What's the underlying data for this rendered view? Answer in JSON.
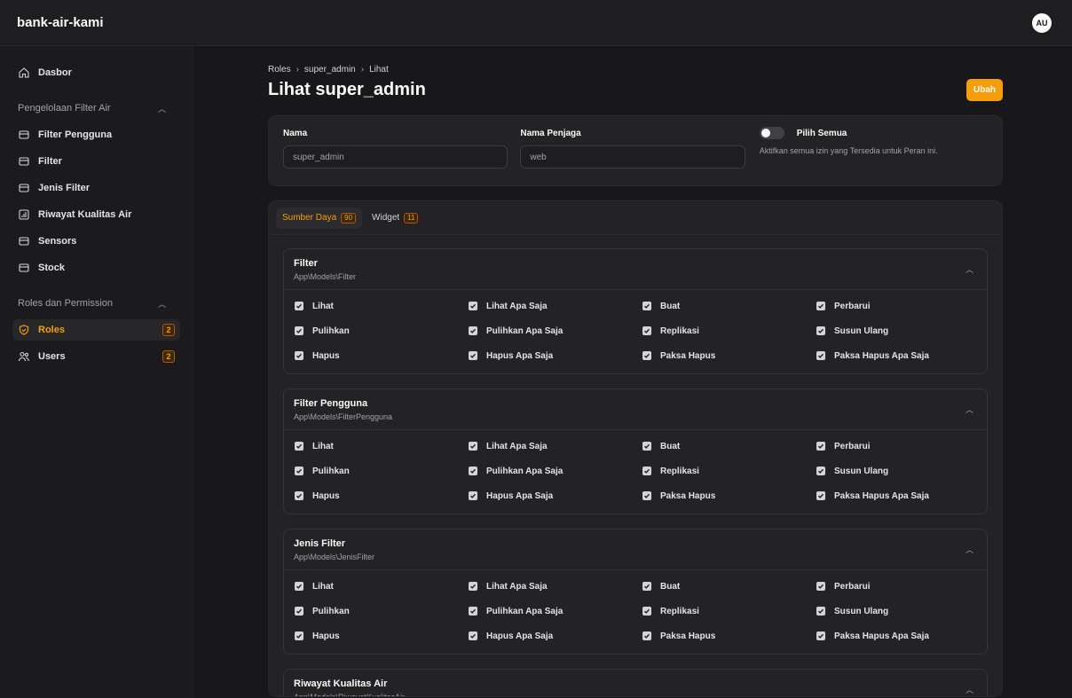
{
  "app": {
    "title": "bank-air-kami",
    "user_initials": "AU"
  },
  "colors": {
    "accent": "#f59e0b",
    "background": "#18181b",
    "surface": "#232326"
  },
  "sidebar": {
    "dashboard": {
      "label": "Dasbor",
      "icon": "home-icon"
    },
    "groups": [
      {
        "label": "Pengelolaan Filter Air",
        "items": [
          {
            "label": "Filter Pengguna",
            "icon": "box-icon"
          },
          {
            "label": "Filter",
            "icon": "box-icon"
          },
          {
            "label": "Jenis Filter",
            "icon": "box-icon"
          },
          {
            "label": "Riwayat Kualitas Air",
            "icon": "chart-icon"
          },
          {
            "label": "Sensors",
            "icon": "box-icon"
          },
          {
            "label": "Stock",
            "icon": "box-icon"
          }
        ]
      },
      {
        "label": "Roles dan Permission",
        "items": [
          {
            "label": "Roles",
            "icon": "shield-check-icon",
            "badge": "2",
            "active": true
          },
          {
            "label": "Users",
            "icon": "users-icon",
            "badge": "2"
          }
        ]
      }
    ]
  },
  "breadcrumb": [
    "Roles",
    "super_admin",
    "Lihat"
  ],
  "page": {
    "title": "Lihat super_admin",
    "edit_label": "Ubah"
  },
  "form": {
    "name_label": "Nama",
    "name_value": "super_admin",
    "guard_label": "Nama Penjaga",
    "guard_value": "web",
    "select_all_label": "Pilih Semua",
    "select_all_help": "Aktifkan semua izin yang Tersedia untuk Peran ini.",
    "select_all_on": false
  },
  "tabs": [
    {
      "label": "Sumber Daya",
      "count": "90",
      "active": true
    },
    {
      "label": "Widget",
      "count": "11",
      "active": false
    }
  ],
  "resources": [
    {
      "title": "Filter",
      "model": "App\\Models\\Filter",
      "permissions": [
        "Lihat",
        "Lihat Apa Saja",
        "Buat",
        "Perbarui",
        "Pulihkan",
        "Pulihkan Apa Saja",
        "Replikasi",
        "Susun Ulang",
        "Hapus",
        "Hapus Apa Saja",
        "Paksa Hapus",
        "Paksa Hapus Apa Saja"
      ]
    },
    {
      "title": "Filter Pengguna",
      "model": "App\\Models\\FilterPengguna",
      "permissions": [
        "Lihat",
        "Lihat Apa Saja",
        "Buat",
        "Perbarui",
        "Pulihkan",
        "Pulihkan Apa Saja",
        "Replikasi",
        "Susun Ulang",
        "Hapus",
        "Hapus Apa Saja",
        "Paksa Hapus",
        "Paksa Hapus Apa Saja"
      ]
    },
    {
      "title": "Jenis Filter",
      "model": "App\\Models\\JenisFilter",
      "permissions": [
        "Lihat",
        "Lihat Apa Saja",
        "Buat",
        "Perbarui",
        "Pulihkan",
        "Pulihkan Apa Saja",
        "Replikasi",
        "Susun Ulang",
        "Hapus",
        "Hapus Apa Saja",
        "Paksa Hapus",
        "Paksa Hapus Apa Saja"
      ]
    },
    {
      "title": "Riwayat Kualitas Air",
      "model": "App\\Models\\RiwayatKualitasAir",
      "permissions": []
    }
  ]
}
